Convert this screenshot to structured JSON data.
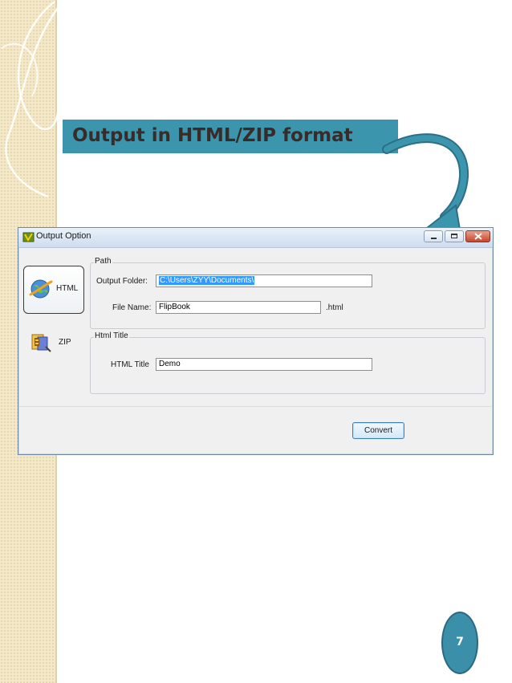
{
  "slide": {
    "title": "Output in HTML/ZIP format",
    "page_number": "7",
    "colors": {
      "banner": "#3b95ad",
      "title_text": "#3b2b28",
      "page_badge": "#3b8fa9"
    }
  },
  "window": {
    "title": "Output Option",
    "nav": [
      {
        "label": "HTML",
        "icon": "globe-icon",
        "selected": true
      },
      {
        "label": "ZIP",
        "icon": "zip-archive-icon",
        "selected": false
      }
    ],
    "path_group": {
      "label": "Path",
      "output_folder_label": "Output Folder:",
      "output_folder_value": "C:\\Users\\ZYY\\Documents\\",
      "file_name_label": "File Name:",
      "file_name_value": "FlipBook",
      "extension": ".html"
    },
    "html_title_group": {
      "label": "Html Title",
      "html_title_label": "HTML Title",
      "html_title_value": "Demo"
    },
    "convert_label": "Convert"
  }
}
